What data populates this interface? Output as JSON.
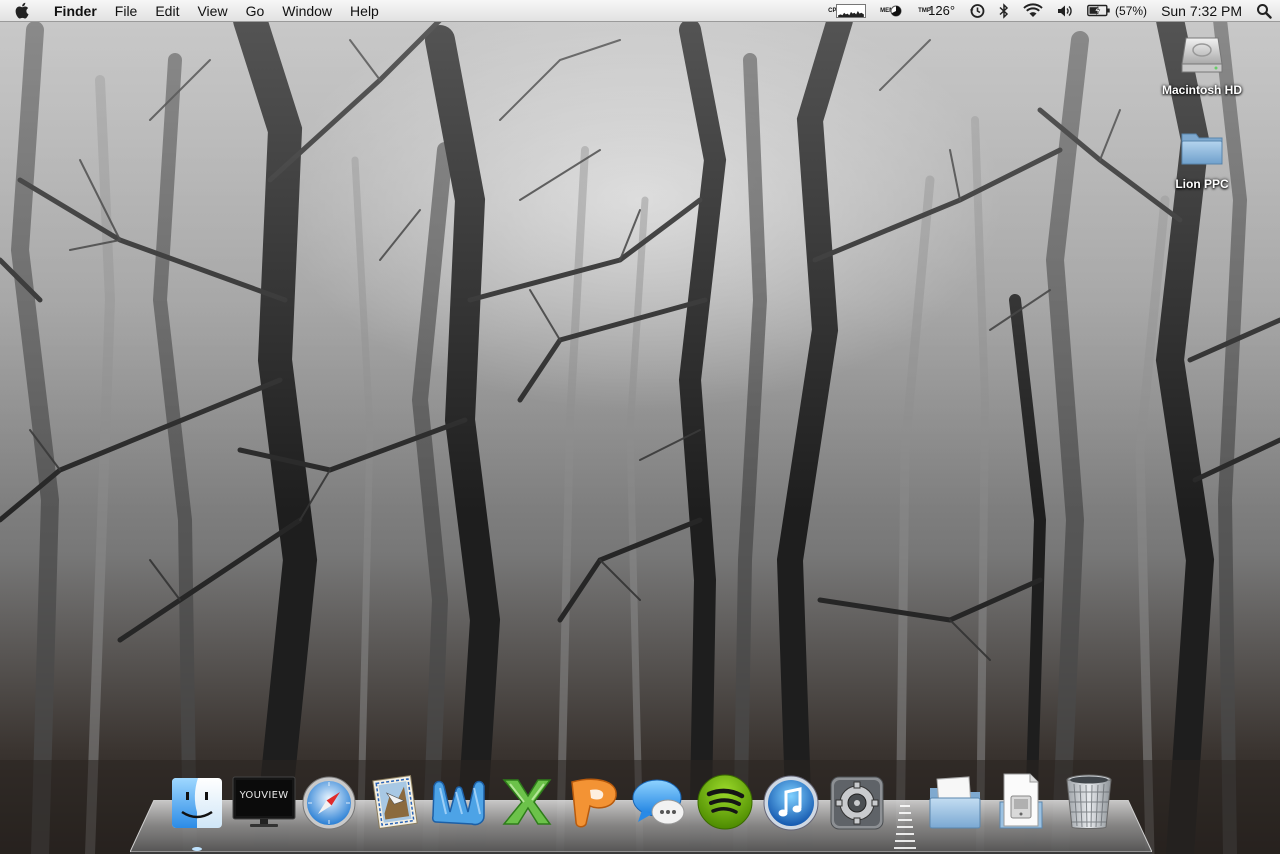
{
  "menubar": {
    "apple_icon": "apple-logo-icon",
    "app_name": "Finder",
    "menus": [
      "File",
      "Edit",
      "View",
      "Go",
      "Window",
      "Help"
    ],
    "status": {
      "cpu_label": "CPU",
      "mem_label": "MEM",
      "temp_label": "TMP",
      "temp_value": "126°",
      "battery_percent": "(57%)",
      "battery_level": 0.57,
      "clock": "Sun 7:32 PM"
    }
  },
  "desktop": {
    "icons": [
      {
        "label": "Macintosh HD",
        "icon": "hard-drive-icon"
      },
      {
        "label": "Lion PPC",
        "icon": "folder-icon"
      }
    ]
  },
  "dock": {
    "items": [
      {
        "name": "Finder",
        "icon": "finder-icon",
        "running": true
      },
      {
        "name": "YouView",
        "icon": "youview-icon",
        "text": "YouView"
      },
      {
        "name": "Safari",
        "icon": "safari-icon"
      },
      {
        "name": "Mail",
        "icon": "mail-icon"
      },
      {
        "name": "Word",
        "icon": "word-icon"
      },
      {
        "name": "Excel",
        "icon": "excel-icon"
      },
      {
        "name": "PowerPoint",
        "icon": "powerpoint-icon"
      },
      {
        "name": "Messages",
        "icon": "messages-icon"
      },
      {
        "name": "Spotify",
        "icon": "spotify-icon"
      },
      {
        "name": "iTunes",
        "icon": "itunes-icon"
      },
      {
        "name": "System Preferences",
        "icon": "system-preferences-icon"
      },
      {
        "name": "Documents",
        "icon": "documents-folder-icon"
      },
      {
        "name": "Downloads",
        "icon": "downloads-stack-icon"
      },
      {
        "name": "Trash",
        "icon": "trash-icon"
      }
    ]
  },
  "colors": {
    "menubar_top": "#f7f7f7",
    "menubar_bottom": "#e2e2e2",
    "spotify_green": "#7ab800",
    "itunes_blue": "#1a6fd6",
    "folder_blue": "#8fb9dc"
  }
}
